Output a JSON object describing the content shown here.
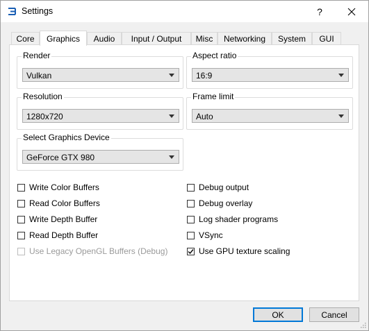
{
  "window": {
    "title": "Settings",
    "help_label": "?",
    "close_label": "✕"
  },
  "tabs": [
    {
      "label": "Core"
    },
    {
      "label": "Graphics"
    },
    {
      "label": "Audio"
    },
    {
      "label": "Input / Output"
    },
    {
      "label": "Misc"
    },
    {
      "label": "Networking"
    },
    {
      "label": "System"
    },
    {
      "label": "GUI"
    }
  ],
  "active_tab": "Graphics",
  "groups": {
    "render": {
      "label": "Render",
      "value": "Vulkan"
    },
    "aspect_ratio": {
      "label": "Aspect ratio",
      "value": "16:9"
    },
    "resolution": {
      "label": "Resolution",
      "value": "1280x720"
    },
    "frame_limit": {
      "label": "Frame limit",
      "value": "Auto"
    },
    "graphics_device": {
      "label": "Select Graphics Device",
      "value": "GeForce GTX 980"
    }
  },
  "checkboxes_left": [
    {
      "label": "Write Color Buffers",
      "checked": false,
      "enabled": true
    },
    {
      "label": "Read Color Buffers",
      "checked": false,
      "enabled": true
    },
    {
      "label": "Write Depth Buffer",
      "checked": false,
      "enabled": true
    },
    {
      "label": "Read Depth Buffer",
      "checked": false,
      "enabled": true
    },
    {
      "label": "Use Legacy OpenGL Buffers (Debug)",
      "checked": false,
      "enabled": false
    }
  ],
  "checkboxes_right": [
    {
      "label": "Debug output",
      "checked": false,
      "enabled": true
    },
    {
      "label": "Debug overlay",
      "checked": false,
      "enabled": true
    },
    {
      "label": "Log shader programs",
      "checked": false,
      "enabled": true
    },
    {
      "label": "VSync",
      "checked": false,
      "enabled": true
    },
    {
      "label": "Use GPU texture scaling",
      "checked": true,
      "enabled": true
    }
  ],
  "buttons": {
    "ok": "OK",
    "cancel": "Cancel"
  },
  "colors": {
    "accent": "#0078d7",
    "disabled_text": "#9a9a9a"
  }
}
